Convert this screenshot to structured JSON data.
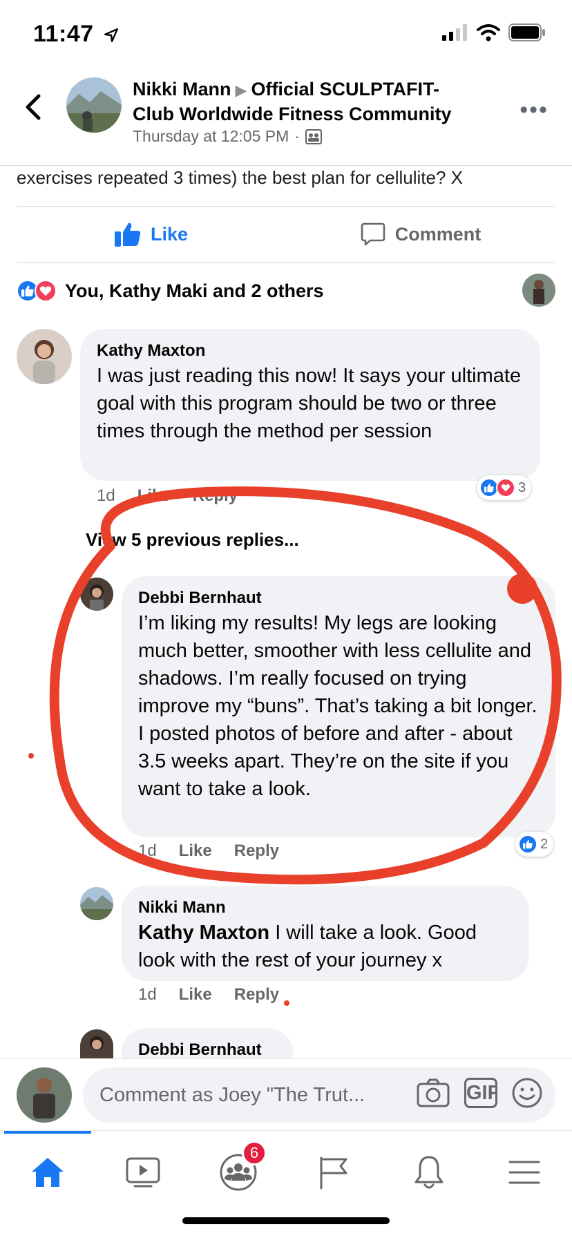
{
  "status_bar": {
    "time": "11:47"
  },
  "header": {
    "author": "Nikki Mann",
    "group": "Official SCULPTAFIT-Club Worldwide Fitness Community",
    "timestamp": "Thursday at 12:05 PM",
    "separator": "·"
  },
  "post": {
    "text_visible": "exercises repeated 3 times) the best plan for cellulite? X"
  },
  "actions": {
    "like_label": "Like",
    "comment_label": "Comment"
  },
  "reactions": {
    "summary": "You, Kathy Maki and 2 others"
  },
  "comments": [
    {
      "name": "Kathy Maxton",
      "text": "I was just reading this now! It says your ultimate goal with this program should be two or three times through the method per session",
      "time": "1d",
      "like": "Like",
      "reply": "Reply",
      "reaction_count": "3"
    },
    {
      "name": "Debbi Bernhaut",
      "text": "I’m liking my results! My legs are looking much better, smoother with less cellulite and shadows. I’m really focused on trying improve my “buns”. That’s taking a bit longer. I posted photos of before and after - about 3.5 weeks apart. They’re on the site if you want to take a look.",
      "time": "1d",
      "like": "Like",
      "reply": "Reply",
      "reaction_count": "2"
    },
    {
      "name": "Nikki Mann",
      "mention": "Kathy Maxton",
      "text": " I will take a look. Good look with the rest of your journey x",
      "time": "1d",
      "like": "Like",
      "reply": "Reply"
    },
    {
      "name": "Debbi Bernhaut"
    }
  ],
  "view_previous": "View 5 previous replies...",
  "composer": {
    "placeholder": "Comment as Joey \"The Trut...",
    "gif_label": "GIF"
  },
  "tabbar": {
    "groups_badge": "6"
  },
  "colors": {
    "accent": "#1877f2",
    "love": "#f33e58",
    "annotation": "#e8402a",
    "badge": "#e41e3f"
  }
}
